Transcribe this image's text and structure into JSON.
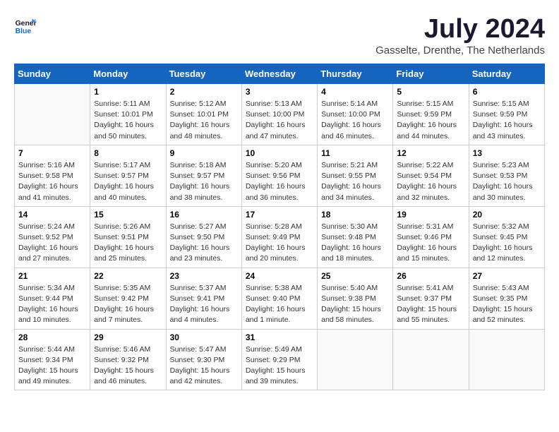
{
  "header": {
    "logo_line1": "General",
    "logo_line2": "Blue",
    "month_title": "July 2024",
    "location": "Gasselte, Drenthe, The Netherlands"
  },
  "weekdays": [
    "Sunday",
    "Monday",
    "Tuesday",
    "Wednesday",
    "Thursday",
    "Friday",
    "Saturday"
  ],
  "weeks": [
    [
      {
        "day": "",
        "info": ""
      },
      {
        "day": "1",
        "info": "Sunrise: 5:11 AM\nSunset: 10:01 PM\nDaylight: 16 hours\nand 50 minutes."
      },
      {
        "day": "2",
        "info": "Sunrise: 5:12 AM\nSunset: 10:01 PM\nDaylight: 16 hours\nand 48 minutes."
      },
      {
        "day": "3",
        "info": "Sunrise: 5:13 AM\nSunset: 10:00 PM\nDaylight: 16 hours\nand 47 minutes."
      },
      {
        "day": "4",
        "info": "Sunrise: 5:14 AM\nSunset: 10:00 PM\nDaylight: 16 hours\nand 46 minutes."
      },
      {
        "day": "5",
        "info": "Sunrise: 5:15 AM\nSunset: 9:59 PM\nDaylight: 16 hours\nand 44 minutes."
      },
      {
        "day": "6",
        "info": "Sunrise: 5:15 AM\nSunset: 9:59 PM\nDaylight: 16 hours\nand 43 minutes."
      }
    ],
    [
      {
        "day": "7",
        "info": "Sunrise: 5:16 AM\nSunset: 9:58 PM\nDaylight: 16 hours\nand 41 minutes."
      },
      {
        "day": "8",
        "info": "Sunrise: 5:17 AM\nSunset: 9:57 PM\nDaylight: 16 hours\nand 40 minutes."
      },
      {
        "day": "9",
        "info": "Sunrise: 5:18 AM\nSunset: 9:57 PM\nDaylight: 16 hours\nand 38 minutes."
      },
      {
        "day": "10",
        "info": "Sunrise: 5:20 AM\nSunset: 9:56 PM\nDaylight: 16 hours\nand 36 minutes."
      },
      {
        "day": "11",
        "info": "Sunrise: 5:21 AM\nSunset: 9:55 PM\nDaylight: 16 hours\nand 34 minutes."
      },
      {
        "day": "12",
        "info": "Sunrise: 5:22 AM\nSunset: 9:54 PM\nDaylight: 16 hours\nand 32 minutes."
      },
      {
        "day": "13",
        "info": "Sunrise: 5:23 AM\nSunset: 9:53 PM\nDaylight: 16 hours\nand 30 minutes."
      }
    ],
    [
      {
        "day": "14",
        "info": "Sunrise: 5:24 AM\nSunset: 9:52 PM\nDaylight: 16 hours\nand 27 minutes."
      },
      {
        "day": "15",
        "info": "Sunrise: 5:26 AM\nSunset: 9:51 PM\nDaylight: 16 hours\nand 25 minutes."
      },
      {
        "day": "16",
        "info": "Sunrise: 5:27 AM\nSunset: 9:50 PM\nDaylight: 16 hours\nand 23 minutes."
      },
      {
        "day": "17",
        "info": "Sunrise: 5:28 AM\nSunset: 9:49 PM\nDaylight: 16 hours\nand 20 minutes."
      },
      {
        "day": "18",
        "info": "Sunrise: 5:30 AM\nSunset: 9:48 PM\nDaylight: 16 hours\nand 18 minutes."
      },
      {
        "day": "19",
        "info": "Sunrise: 5:31 AM\nSunset: 9:46 PM\nDaylight: 16 hours\nand 15 minutes."
      },
      {
        "day": "20",
        "info": "Sunrise: 5:32 AM\nSunset: 9:45 PM\nDaylight: 16 hours\nand 12 minutes."
      }
    ],
    [
      {
        "day": "21",
        "info": "Sunrise: 5:34 AM\nSunset: 9:44 PM\nDaylight: 16 hours\nand 10 minutes."
      },
      {
        "day": "22",
        "info": "Sunrise: 5:35 AM\nSunset: 9:42 PM\nDaylight: 16 hours\nand 7 minutes."
      },
      {
        "day": "23",
        "info": "Sunrise: 5:37 AM\nSunset: 9:41 PM\nDaylight: 16 hours\nand 4 minutes."
      },
      {
        "day": "24",
        "info": "Sunrise: 5:38 AM\nSunset: 9:40 PM\nDaylight: 16 hours\nand 1 minute."
      },
      {
        "day": "25",
        "info": "Sunrise: 5:40 AM\nSunset: 9:38 PM\nDaylight: 15 hours\nand 58 minutes."
      },
      {
        "day": "26",
        "info": "Sunrise: 5:41 AM\nSunset: 9:37 PM\nDaylight: 15 hours\nand 55 minutes."
      },
      {
        "day": "27",
        "info": "Sunrise: 5:43 AM\nSunset: 9:35 PM\nDaylight: 15 hours\nand 52 minutes."
      }
    ],
    [
      {
        "day": "28",
        "info": "Sunrise: 5:44 AM\nSunset: 9:34 PM\nDaylight: 15 hours\nand 49 minutes."
      },
      {
        "day": "29",
        "info": "Sunrise: 5:46 AM\nSunset: 9:32 PM\nDaylight: 15 hours\nand 46 minutes."
      },
      {
        "day": "30",
        "info": "Sunrise: 5:47 AM\nSunset: 9:30 PM\nDaylight: 15 hours\nand 42 minutes."
      },
      {
        "day": "31",
        "info": "Sunrise: 5:49 AM\nSunset: 9:29 PM\nDaylight: 15 hours\nand 39 minutes."
      },
      {
        "day": "",
        "info": ""
      },
      {
        "day": "",
        "info": ""
      },
      {
        "day": "",
        "info": ""
      }
    ]
  ]
}
